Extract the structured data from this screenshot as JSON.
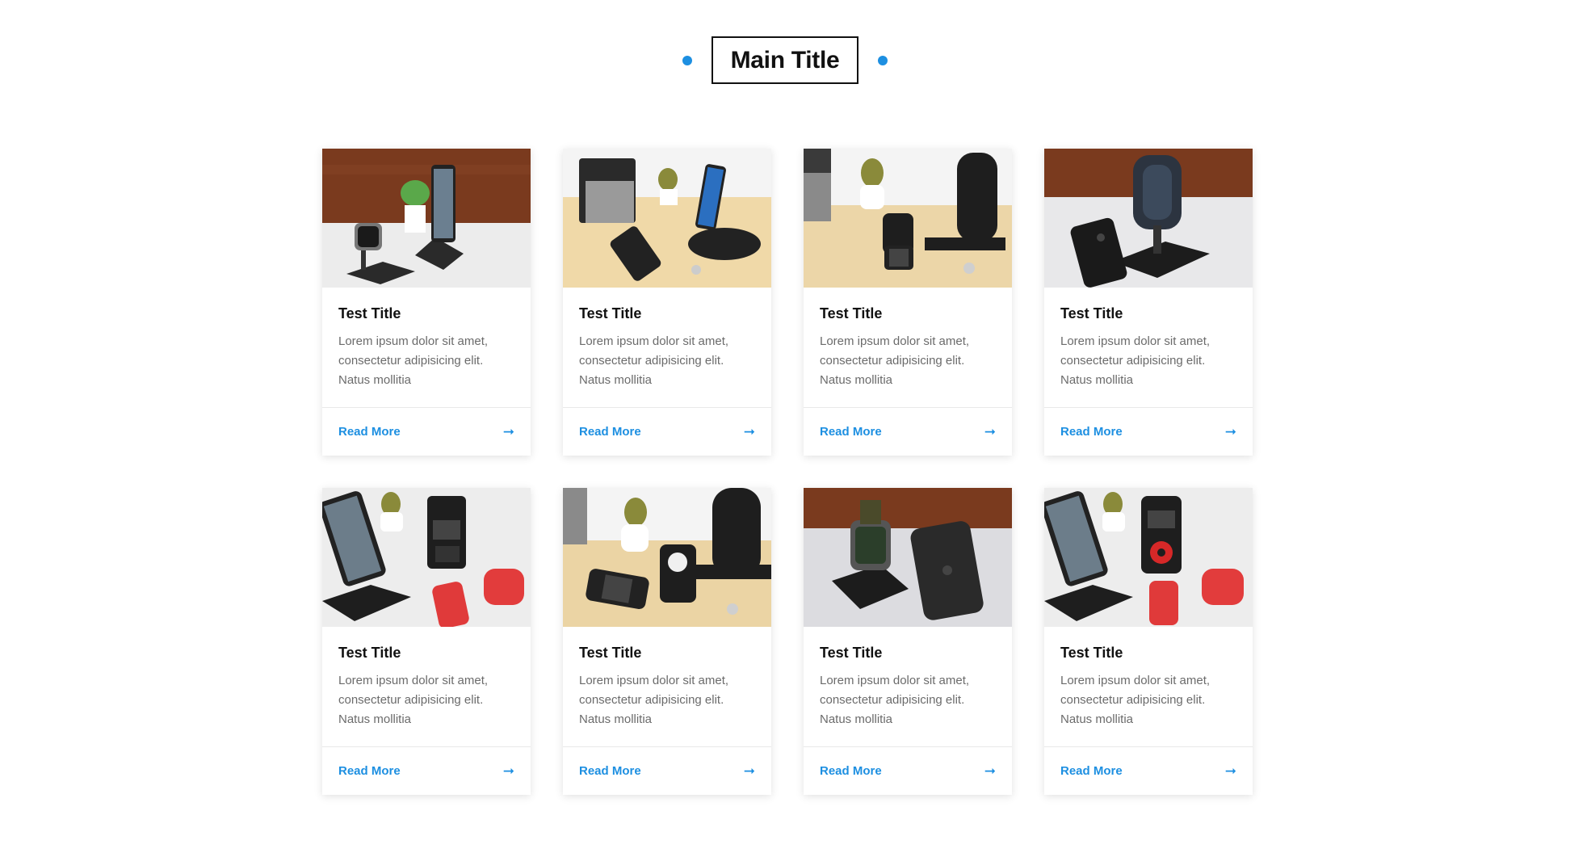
{
  "header": {
    "main_title": "Main Title",
    "accent_color": "#1d8fe1"
  },
  "cards": [
    {
      "title": "Test Title",
      "text": "Lorem ipsum dolor sit amet, consectetur adipisicing elit. Natus mollitia",
      "link": "Read More",
      "image": "wireless-charging-stand-with-watch-and-phone"
    },
    {
      "title": "Test Title",
      "text": "Lorem ipsum dolor sit amet, consectetur adipisicing elit. Natus mollitia",
      "link": "Read More",
      "image": "charging-dock-with-speaker-and-phones"
    },
    {
      "title": "Test Title",
      "text": "Lorem ipsum dolor sit amet, consectetur adipisicing elit. Natus mollitia",
      "link": "Read More",
      "image": "charging-stand-with-watch-dock"
    },
    {
      "title": "Test Title",
      "text": "Lorem ipsum dolor sit amet, consectetur adipisicing elit. Natus mollitia",
      "link": "Read More",
      "image": "magnetic-phone-mount-stand"
    },
    {
      "title": "Test Title",
      "text": "Lorem ipsum dolor sit amet, consectetur adipisicing elit. Natus mollitia",
      "link": "Read More",
      "image": "phone-stand-with-retro-watch-dock"
    },
    {
      "title": "Test Title",
      "text": "Lorem ipsum dolor sit amet, consectetur adipisicing elit. Natus mollitia",
      "link": "Read More",
      "image": "power-bank-with-watch-and-stand"
    },
    {
      "title": "Test Title",
      "text": "Lorem ipsum dolor sit amet, consectetur adipisicing elit. Natus mollitia",
      "link": "Read More",
      "image": "watch-charging-pad-and-phone"
    },
    {
      "title": "Test Title",
      "text": "Lorem ipsum dolor sit amet, consectetur adipisicing elit. Natus mollitia",
      "link": "Read More",
      "image": "phone-stand-with-red-watch-dock"
    }
  ]
}
